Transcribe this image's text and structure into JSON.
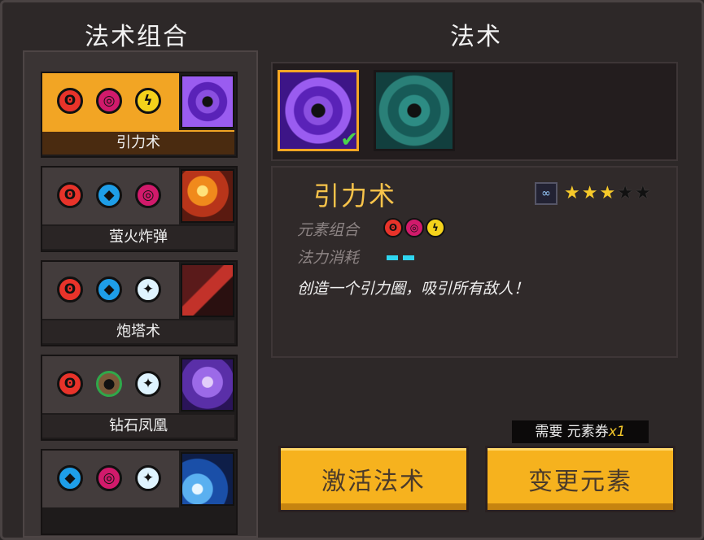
{
  "left_title": "法术组合",
  "right_title": "法术",
  "combos": [
    {
      "name": "引力术",
      "elements": [
        "fire",
        "void",
        "light"
      ],
      "selected": true
    },
    {
      "name": "萤火炸弹",
      "elements": [
        "fire",
        "water",
        "void"
      ],
      "selected": false
    },
    {
      "name": "炮塔术",
      "elements": [
        "fire",
        "water",
        "ice"
      ],
      "selected": false
    },
    {
      "name": "钻石凤凰",
      "elements": [
        "fire",
        "earth",
        "ice"
      ],
      "selected": false
    },
    {
      "name": "",
      "elements": [
        "water",
        "void",
        "ice"
      ],
      "selected": false
    }
  ],
  "detail": {
    "spell_name": "引力术",
    "stars_filled": 3,
    "stars_total": 5,
    "element_label": "元素组合",
    "cost_label": "法力消耗",
    "mana_cost": 2,
    "description": "创造一个引力圈，吸引所有敌人！"
  },
  "buttons": {
    "activate": "激活法术",
    "change": "变更元素"
  },
  "requirement": {
    "text": "需要 元素券",
    "count": "x1"
  },
  "icons": {
    "fire": "fire-element-icon",
    "water": "water-element-icon",
    "void": "void-element-icon",
    "light": "lightning-element-icon",
    "ice": "ice-element-icon",
    "earth": "earth-element-icon"
  }
}
